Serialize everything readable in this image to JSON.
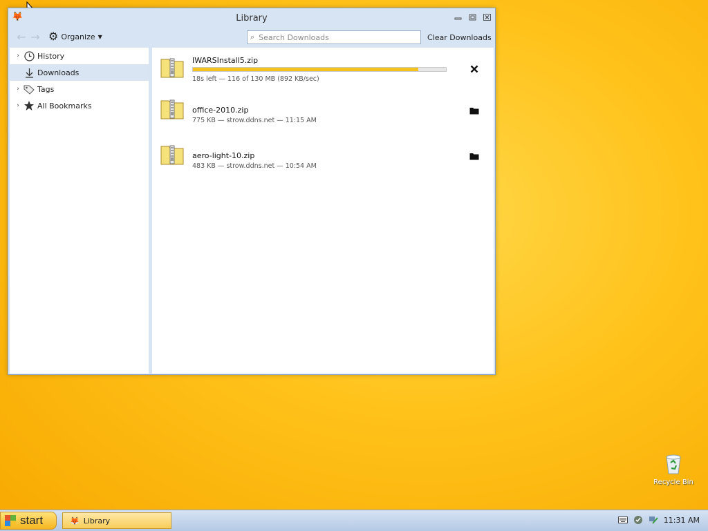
{
  "window": {
    "title": "Library",
    "controls": [
      "minimize-icon",
      "maximize-icon",
      "close-icon"
    ]
  },
  "toolbar": {
    "organize_label": "Organize",
    "search_placeholder": "Search Downloads",
    "clear_label": "Clear Downloads"
  },
  "sidebar": {
    "items": [
      {
        "label": "History",
        "icon": "clock-icon",
        "expandable": true
      },
      {
        "label": "Downloads",
        "icon": "download-arrow-icon",
        "expandable": false,
        "selected": true
      },
      {
        "label": "Tags",
        "icon": "tag-icon",
        "expandable": true
      },
      {
        "label": "All Bookmarks",
        "icon": "star-icon",
        "expandable": true
      }
    ]
  },
  "downloads": [
    {
      "name": "IWARSInstall5.zip",
      "status": "18s left — 116 of 130 MB (892 KB/sec)",
      "progress": 0.892,
      "action": "cancel"
    },
    {
      "name": "office-2010.zip",
      "status": "775 KB — strow.ddns.net — 11:15 AM",
      "action": "open-folder"
    },
    {
      "name": "aero-light-10.zip",
      "status": "483 KB — strow.ddns.net — 10:54 AM",
      "action": "open-folder"
    }
  ],
  "desktop": {
    "recycle_bin_label": "Recycle Bin"
  },
  "taskbar": {
    "start_label": "start",
    "task_label": "Library",
    "clock": "11:31 AM"
  },
  "colors": {
    "progress_fill": "#f3c21c",
    "selection": "#d9e5f3"
  }
}
